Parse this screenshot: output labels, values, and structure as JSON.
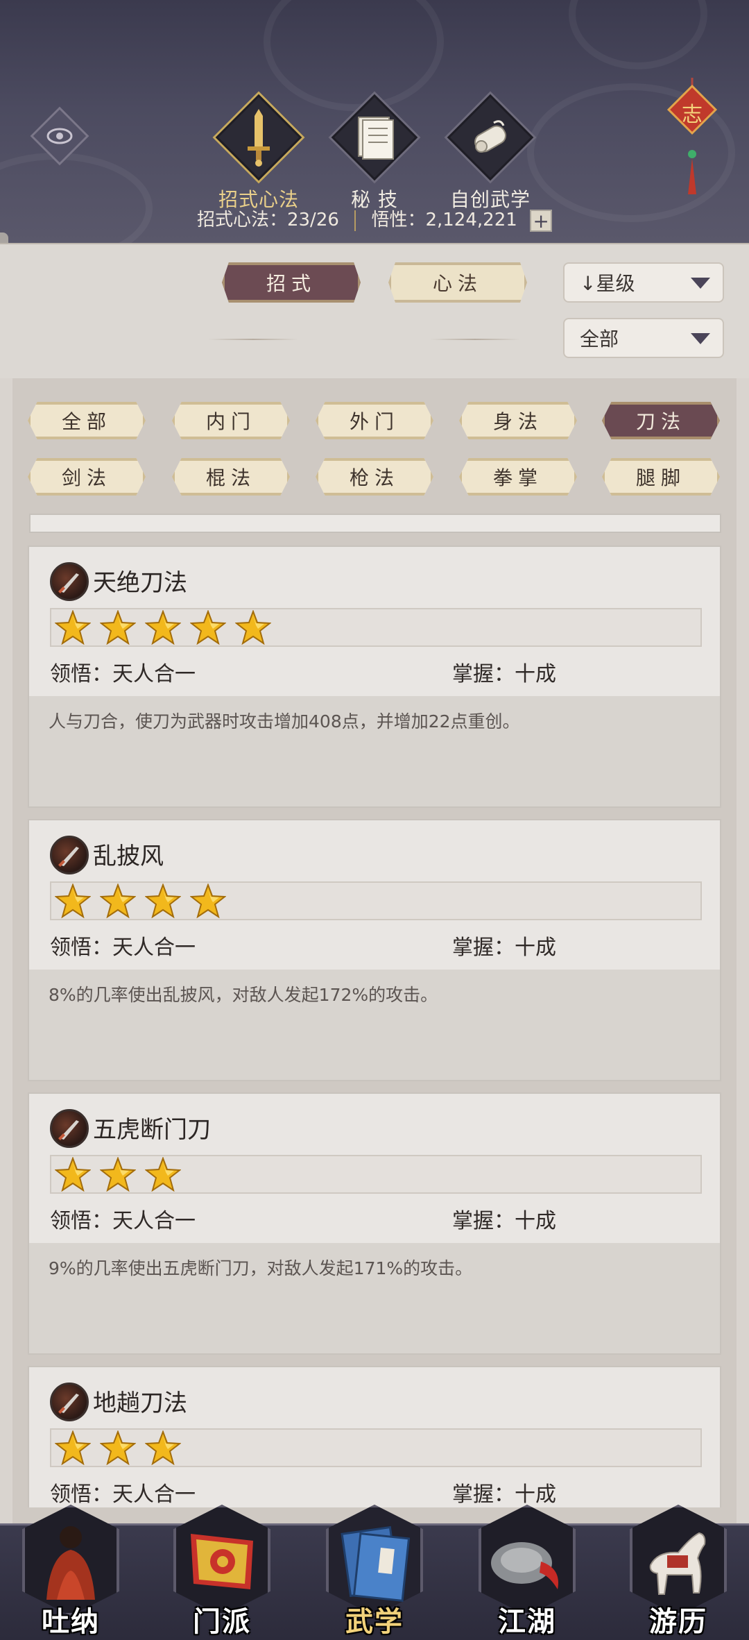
{
  "header": {
    "main_tabs": [
      {
        "label": "招式心法",
        "icon": "sword-icon",
        "active": true
      },
      {
        "label": "秘 技",
        "icon": "book-icon",
        "active": false
      },
      {
        "label": "自创武学",
        "icon": "scroll-icon",
        "active": false
      }
    ],
    "stats_label": "招式心法：",
    "stats_value": "23/26",
    "insight_label": "悟性：",
    "insight_value": "2,124,221",
    "plus_label": "+",
    "knot_char": "志"
  },
  "filters": {
    "type_tabs": [
      {
        "label": "招式",
        "active": true
      },
      {
        "label": "心法",
        "active": false
      }
    ],
    "sort_select": "↓星级",
    "scope_select": "全部"
  },
  "categories": [
    {
      "label": "全部",
      "active": false
    },
    {
      "label": "内门",
      "active": false
    },
    {
      "label": "外门",
      "active": false
    },
    {
      "label": "身法",
      "active": false
    },
    {
      "label": "刀法",
      "active": true
    },
    {
      "label": "剑法",
      "active": false
    },
    {
      "label": "棍法",
      "active": false
    },
    {
      "label": "枪法",
      "active": false
    },
    {
      "label": "拳掌",
      "active": false
    },
    {
      "label": "腿脚",
      "active": false
    }
  ],
  "skills": [
    {
      "name": "天绝刀法",
      "stars": 5,
      "comprehension_label": "领悟：",
      "comprehension": "天人合一",
      "mastery_label": "掌握：",
      "mastery": "十成",
      "description": "人与刀合，使刀为武器时攻击增加408点，并增加22点重创。"
    },
    {
      "name": "乱披风",
      "stars": 4,
      "comprehension_label": "领悟：",
      "comprehension": "天人合一",
      "mastery_label": "掌握：",
      "mastery": "十成",
      "description": "8%的几率使出乱披风，对敌人发起172%的攻击。"
    },
    {
      "name": "五虎断门刀",
      "stars": 3,
      "comprehension_label": "领悟：",
      "comprehension": "天人合一",
      "mastery_label": "掌握：",
      "mastery": "十成",
      "description": "9%的几率使出五虎断门刀，对敌人发起171%的攻击。"
    },
    {
      "name": "地趟刀法",
      "stars": 3,
      "comprehension_label": "领悟：",
      "comprehension": "天人合一",
      "mastery_label": "掌握：",
      "mastery": "十成",
      "description": ""
    }
  ],
  "bottom_nav": [
    {
      "label": "吐纳",
      "icon": "meditation-monk-icon",
      "active": false
    },
    {
      "label": "门派",
      "icon": "sect-banner-icon",
      "active": false
    },
    {
      "label": "武学",
      "icon": "martial-manual-icon",
      "active": true
    },
    {
      "label": "江湖",
      "icon": "straw-hat-icon",
      "active": false
    },
    {
      "label": "游历",
      "icon": "horse-icon",
      "active": false
    }
  ],
  "colors": {
    "header_bg": "#4c4b60",
    "active_gold": "#ead08a",
    "active_tab_bg": "#6c4b53",
    "star": "#f2b81c"
  }
}
